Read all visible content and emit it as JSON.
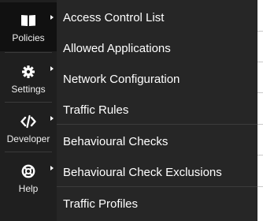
{
  "sidebar": {
    "items": [
      {
        "label": "Policies",
        "icon": "book-icon"
      },
      {
        "label": "Settings",
        "icon": "gear-icon"
      },
      {
        "label": "Developer",
        "icon": "code-icon"
      },
      {
        "label": "Help",
        "icon": "lifebuoy-icon"
      }
    ]
  },
  "submenu": {
    "items": [
      "Access Control List",
      "Allowed Applications",
      "Network Configuration",
      "Traffic Rules",
      "Behavioural Checks",
      "Behavioural Check Exclusions",
      "Traffic Profiles"
    ]
  },
  "colors": {
    "sidebar_bg": "#1f1f1f",
    "menu_bg": "#262626",
    "text": "#ffffff"
  }
}
